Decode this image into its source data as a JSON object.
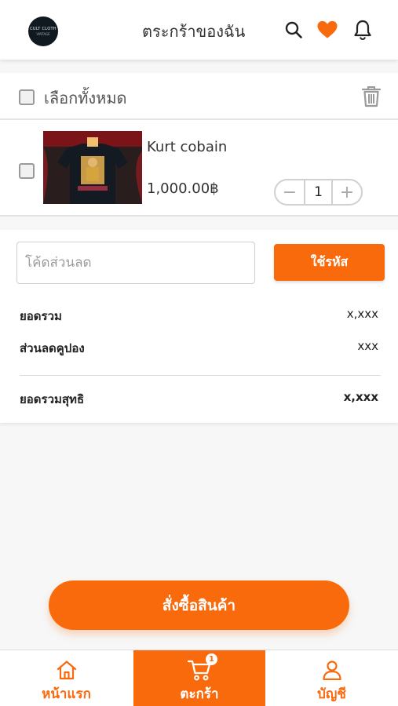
{
  "header": {
    "title": "ตระกร้าของฉัน",
    "logo": {
      "line1": "CULT CLOTH",
      "line2": "VINTAGE"
    },
    "icons": [
      "search-icon",
      "heart-icon",
      "bell-icon"
    ]
  },
  "select_all": {
    "label": "เลือกทั้งหมด",
    "checked": false
  },
  "cart_items": [
    {
      "name": "Kurt cobain",
      "price": "1,000.00฿",
      "quantity": "1",
      "checked": false
    }
  ],
  "quantity_controls": {
    "minus": "−",
    "plus": "+"
  },
  "coupon": {
    "placeholder": "โค้ดส่วนลด",
    "value": "",
    "apply_label": "ใช้รหัส"
  },
  "summary": {
    "subtotal_label": "ยอดรวม",
    "subtotal_value": "x,xxx",
    "discount_label": "ส่วนลดคูปอง",
    "discount_value": "xxx",
    "total_label": "ยอดรวมสุทธิ",
    "total_value": "x,xxx"
  },
  "order_button": {
    "label": "สั่งซื้อสินค้า"
  },
  "bottom_nav": {
    "items": [
      {
        "label": "หน้าแรก",
        "icon": "home-icon",
        "active": false
      },
      {
        "label": "ตะกร้า",
        "icon": "cart-icon",
        "active": true,
        "badge": "1"
      },
      {
        "label": "บัญชี",
        "icon": "user-icon",
        "active": false
      }
    ]
  },
  "colors": {
    "accent": "#f96a0c",
    "background": "#f7f7f7",
    "surface": "#ffffff"
  }
}
